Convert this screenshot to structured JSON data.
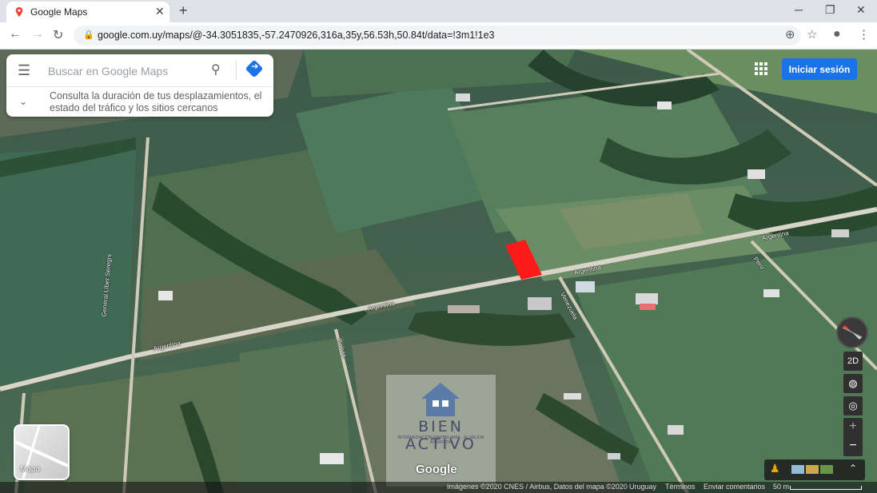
{
  "browser": {
    "tab_title": "Google Maps",
    "url": "google.com.uy/maps/@-34.3051835,-57.2470926,316a,35y,56.53h,50.84t/data=!3m1!1e3"
  },
  "search": {
    "placeholder": "Buscar en Google Maps",
    "traffic_hint": "Consulta la duración de tus desplazamientos, el estado del tráfico y los sitios cercanos"
  },
  "header": {
    "signin_label": "Iniciar sesión"
  },
  "controls": {
    "mode_2d": "2D",
    "zoom_in": "+",
    "zoom_out": "−",
    "layer_label": "Mapa"
  },
  "road_labels": [
    "Argentina",
    "Argentina",
    "Argentina",
    "Argentina",
    "Bolivia",
    "General Líber Seregni",
    "Venezuela",
    "Perú"
  ],
  "watermark": {
    "title": "BIEN ACTIVO",
    "subtitle": "INTERMEDIACIÓN INMOBILIARIA · SU MEJOR INVERSIÓN"
  },
  "google_logo": "Google",
  "footer": {
    "attribution": "Imágenes ©2020 CNES / Airbus, Datos del mapa ©2020",
    "country": "Uruguay",
    "terms": "Términos",
    "feedback": "Enviar comentarios",
    "scale": "50 m"
  },
  "colors": {
    "highlight_parcel": "#ff1a1a",
    "signin_blue": "#1a73e8"
  }
}
